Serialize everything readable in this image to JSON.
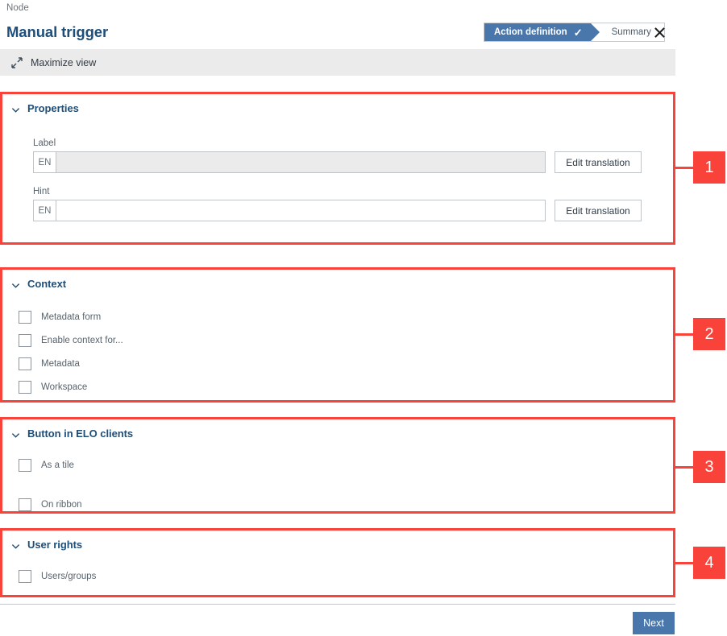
{
  "header": {
    "breadcrumb": "Node",
    "title": "Manual trigger",
    "close_icon": "close-icon",
    "steps": [
      {
        "label": "Action definition",
        "state": "active",
        "check": "✓"
      },
      {
        "label": "Summary",
        "state": "inactive"
      }
    ]
  },
  "toolbar": {
    "maximize_icon": "maximize-icon",
    "maximize_label": "Maximize view"
  },
  "sections": [
    {
      "id": "properties",
      "title": "Properties",
      "chevron": "chevron-down-icon",
      "fields": [
        {
          "label": "Label",
          "lang": "EN",
          "value": "",
          "placeholder": "",
          "disabled": true,
          "button": "Edit translation"
        },
        {
          "label": "Hint",
          "lang": "EN",
          "value": "",
          "placeholder": "",
          "disabled": false,
          "button": "Edit translation"
        }
      ]
    },
    {
      "id": "context",
      "title": "Context",
      "chevron": "chevron-down-icon",
      "checkboxes": [
        {
          "label": "Metadata form",
          "checked": false
        },
        {
          "label": "Enable context for...",
          "checked": false
        },
        {
          "label": "Metadata",
          "checked": false
        },
        {
          "label": "Workspace",
          "checked": false
        }
      ]
    },
    {
      "id": "button-in-elo-clients",
      "title": "Button in ELO clients",
      "chevron": "chevron-down-icon",
      "checkboxes": [
        {
          "label": "As a tile",
          "checked": false
        },
        {
          "label": "On ribbon",
          "checked": false
        }
      ]
    },
    {
      "id": "user-rights",
      "title": "User rights",
      "chevron": "chevron-down-icon",
      "checkboxes": [
        {
          "label": "Users/groups",
          "checked": false
        }
      ]
    }
  ],
  "annotations": [
    {
      "number": "1"
    },
    {
      "number": "2"
    },
    {
      "number": "3"
    },
    {
      "number": "4"
    }
  ],
  "footer": {
    "next_label": "Next"
  },
  "colors": {
    "annotation_red": "#f9423a",
    "brand_blue": "#1f4e79",
    "accent_blue": "#4a77ab",
    "bar_gray": "#ebebeb",
    "disabled_gray": "#ebebeb"
  }
}
